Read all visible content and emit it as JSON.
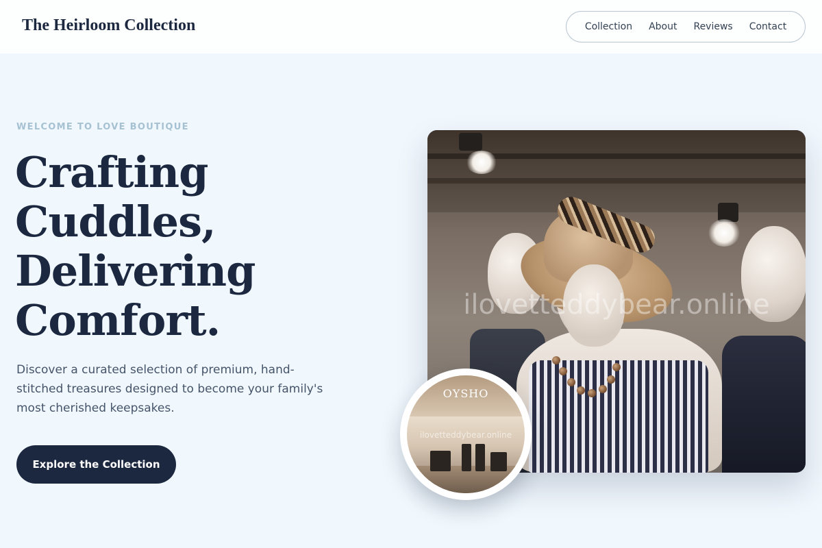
{
  "header": {
    "brand": "The Heirloom Collection",
    "nav": [
      {
        "label": "Collection"
      },
      {
        "label": "About"
      },
      {
        "label": "Reviews"
      },
      {
        "label": "Contact"
      }
    ]
  },
  "hero": {
    "eyebrow": "WELCOME TO LOVE BOUTIQUE",
    "headline": [
      "Crafting",
      "Cuddles,",
      "Delivering",
      "Comfort."
    ],
    "description": "Discover a curated selection of premium, hand-stitched treasures designed to become your family's most cherished keepsakes.",
    "cta_label": "Explore the Collection"
  },
  "media": {
    "main_watermark": "ilovetteddybear.online",
    "badge_store_sign": "OYSHO",
    "badge_watermark": "ilovetteddybear.online"
  },
  "colors": {
    "background": "#f0f7fd",
    "primary": "#1c2840",
    "eyebrow": "#a6c2d2",
    "body_text": "#46546a"
  }
}
